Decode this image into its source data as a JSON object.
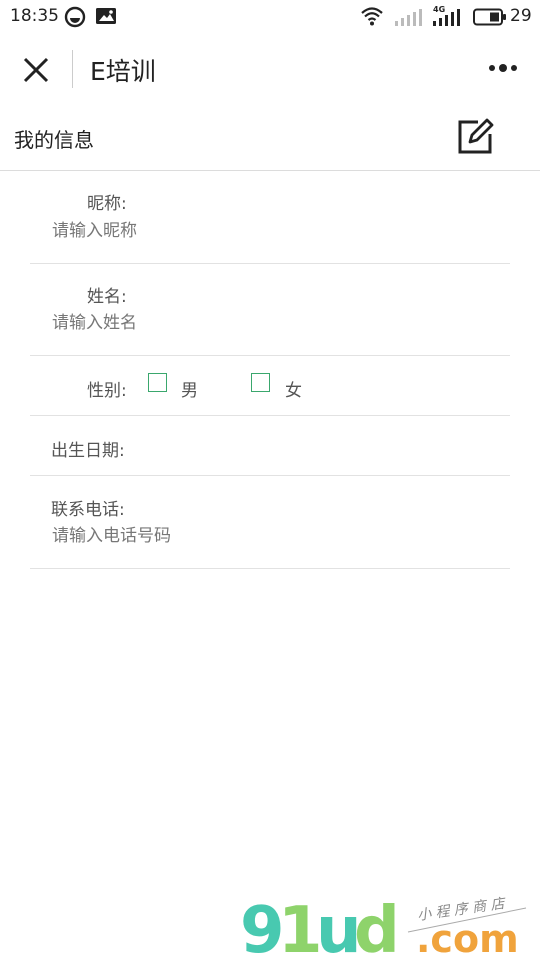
{
  "status_bar": {
    "time": "18:35",
    "network_label": "4G",
    "battery_percent": "29",
    "icons": [
      "sync-icon",
      "photo-notification-icon",
      "wifi-icon",
      "signal-icon",
      "signal-4g-icon",
      "battery-icon"
    ]
  },
  "nav": {
    "title": "E培训",
    "close_icon": "close-icon",
    "more_icon": "more-icon"
  },
  "section": {
    "title": "我的信息",
    "edit_icon": "edit-icon"
  },
  "form": {
    "nickname": {
      "label": "昵称:",
      "placeholder": "请输入昵称"
    },
    "name": {
      "label": "姓名:",
      "placeholder": "请输入姓名"
    },
    "gender": {
      "label": "性别:",
      "options": [
        "男",
        "女"
      ],
      "checked": [
        false,
        false
      ]
    },
    "birthday": {
      "label": "出生日期:"
    },
    "phone": {
      "label": "联系电话:",
      "placeholder": "请输入电话号码"
    }
  },
  "watermark": {
    "logo": "91ud",
    "domain": ".com",
    "tagline": "小程序商店"
  },
  "colors": {
    "checkbox_border": "#3aa76d",
    "divider": "#e2e2e2",
    "watermark_teal": "#48c9b0",
    "watermark_green": "#8ed36b",
    "watermark_orange": "#f0a33c"
  }
}
